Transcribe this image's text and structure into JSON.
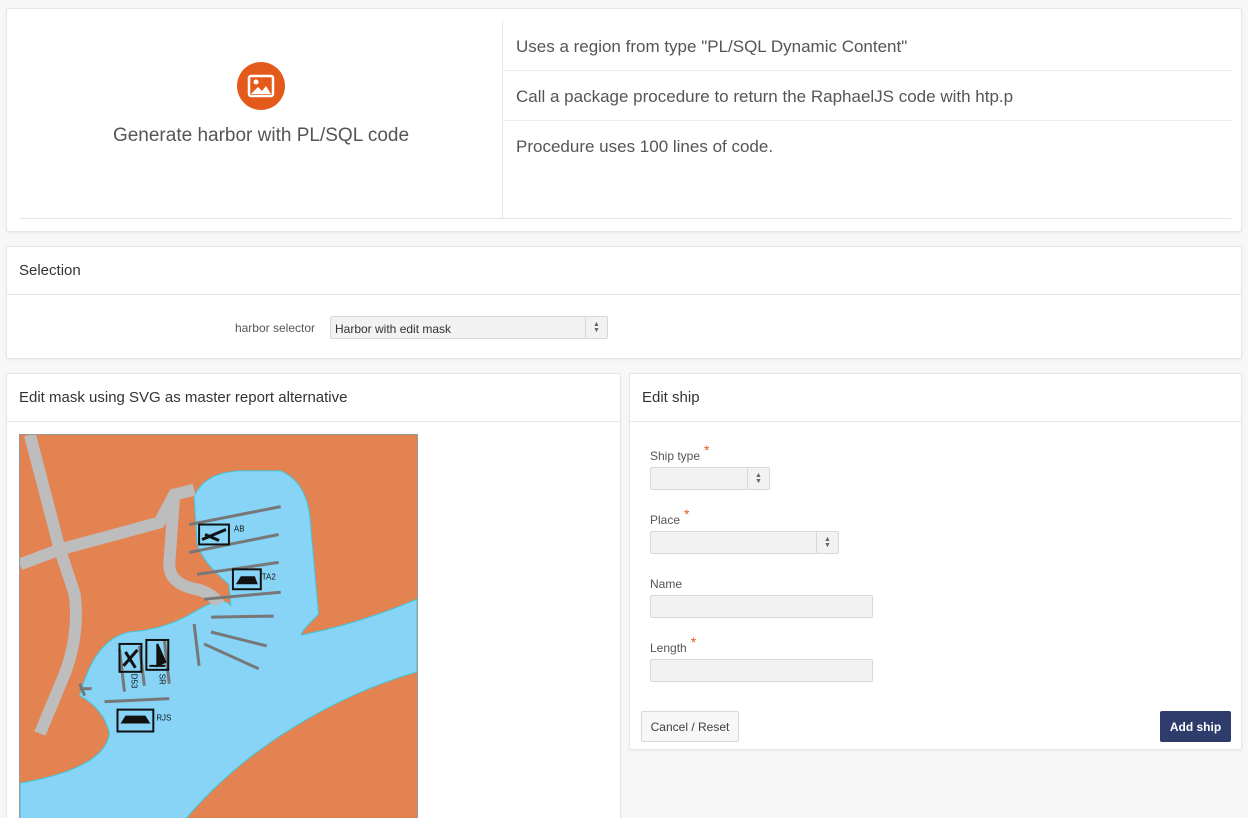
{
  "hero": {
    "title": "Generate harbor with PL/SQL code",
    "icon": "image-icon",
    "accent": "#e35a1b",
    "lines": [
      "Uses a region from type \"PL/SQL Dynamic Content\"",
      "Call a package procedure to return the RaphaelJS code with htp.p",
      "Procedure uses 100 lines of code."
    ]
  },
  "selection": {
    "title": "Selection",
    "label": "harbor selector",
    "value": "Harbor with edit mask"
  },
  "map_region": {
    "title": "Edit mask using SVG as master report alternative",
    "ships": [
      "AB",
      "TA2",
      "D53",
      "SR",
      "RJS"
    ],
    "colors": {
      "land": "#e38352",
      "water": "#87d4f7",
      "road": "#bdbdbd",
      "pier": "#777777"
    }
  },
  "edit_ship": {
    "title": "Edit ship",
    "required_marker": "*",
    "fields": {
      "ship_type": {
        "label": "Ship type",
        "value": ""
      },
      "place": {
        "label": "Place",
        "value": ""
      },
      "name": {
        "label": "Name",
        "value": ""
      },
      "length": {
        "label": "Length",
        "value": ""
      }
    },
    "cancel_label": "Cancel / Reset",
    "add_label": "Add ship",
    "button_color": "#2e3c6b"
  }
}
